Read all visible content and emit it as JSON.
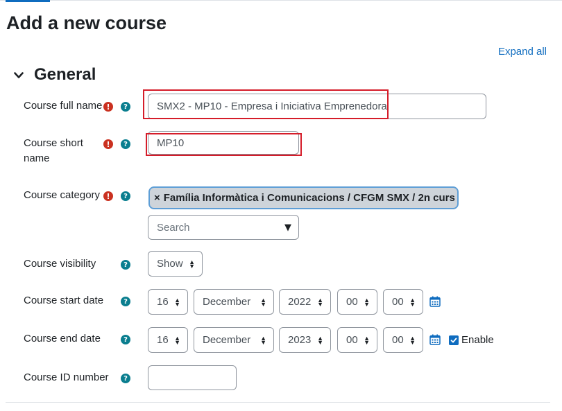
{
  "page": {
    "title": "Add a new course",
    "expand_all": "Expand all"
  },
  "section": {
    "title": "General"
  },
  "fields": {
    "fullname": {
      "label": "Course full name",
      "value": "SMX2 - MP10 - Empresa i Iniciativa Emprenedora"
    },
    "shortname": {
      "label_line1": "Course short",
      "label_line2": "name",
      "value": "MP10"
    },
    "category": {
      "label": "Course category",
      "selected": "Família Informàtica i Comunicacions / CFGM SMX / 2n curs",
      "remove_glyph": "×",
      "search_placeholder": "Search",
      "dropdown_glyph": "▼"
    },
    "visibility": {
      "label": "Course visibility",
      "value": "Show"
    },
    "startdate": {
      "label": "Course start date",
      "day": "16",
      "month": "December",
      "year": "2022",
      "hour": "00",
      "minute": "00"
    },
    "enddate": {
      "label": "Course end date",
      "day": "16",
      "month": "December",
      "year": "2023",
      "hour": "00",
      "minute": "00",
      "enable_label": "Enable",
      "enabled": true
    },
    "idnumber": {
      "label": "Course ID number",
      "value": ""
    }
  },
  "icons": {
    "required": "required-icon",
    "help": "help-icon",
    "calendar": "calendar-icon",
    "collapse": "chevron-down-icon",
    "select_arrows": "updown-arrows-icon"
  },
  "colors": {
    "link": "#0f6cbf",
    "required": "#ca3120",
    "help": "#0a7e8f",
    "highlight_box": "#d51d2a"
  }
}
